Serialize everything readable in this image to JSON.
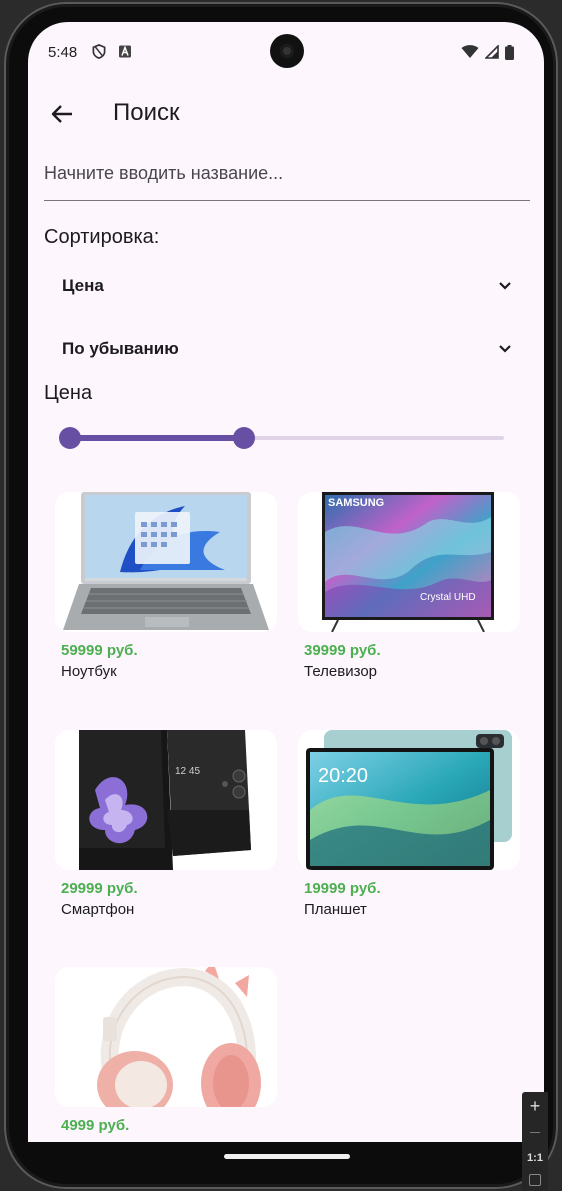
{
  "status_bar": {
    "time": "5:48"
  },
  "app_bar": {
    "title": "Поиск"
  },
  "search": {
    "placeholder": "Начните вводить название...",
    "value": ""
  },
  "sorting": {
    "label": "Сортировка:",
    "field": "Цена",
    "order": "По убыванию"
  },
  "price_filter": {
    "label": "Цена",
    "range_start_fraction": 0,
    "range_end_fraction": 0.4
  },
  "products": [
    {
      "price": "59999 руб.",
      "name": "Ноутбук",
      "icon": "laptop-image"
    },
    {
      "price": "39999 руб.",
      "name": "Телевизор",
      "icon": "tv-image"
    },
    {
      "price": "29999 руб.",
      "name": "Смартфон",
      "icon": "smartphone-image"
    },
    {
      "price": "19999 руб.",
      "name": "Планшет",
      "icon": "tablet-image"
    },
    {
      "price": "4999 руб.",
      "name": "",
      "icon": "headphones-image"
    }
  ],
  "images": {
    "tv_brand": "SAMSUNG",
    "tv_badge": "Crystal UHD",
    "phone_time": "12 45",
    "tablet_time": "20:20"
  },
  "emulator_tools": {
    "zoom_in": "+",
    "zoom_reset": "1:1"
  },
  "colors": {
    "accent": "#6750a4",
    "price": "#4caf50",
    "background": "#fdf6fd"
  }
}
